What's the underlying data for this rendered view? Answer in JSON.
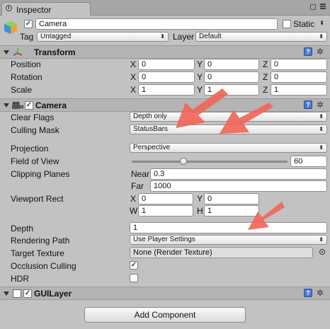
{
  "window": {
    "tab_title": "Inspector"
  },
  "object": {
    "name": "Camera",
    "static_label": "Static",
    "tag_label": "Tag",
    "tag_value": "Untagged",
    "layer_label": "Layer",
    "layer_value": "Default"
  },
  "transform": {
    "title": "Transform",
    "rows": [
      {
        "label": "Position",
        "x": "0",
        "y": "0",
        "z": "0"
      },
      {
        "label": "Rotation",
        "x": "0",
        "y": "0",
        "z": "0"
      },
      {
        "label": "Scale",
        "x": "1",
        "y": "1",
        "z": "1"
      }
    ],
    "axis_x": "X",
    "axis_y": "Y",
    "axis_z": "Z"
  },
  "camera": {
    "title": "Camera",
    "clear_flags_label": "Clear Flags",
    "clear_flags_value": "Depth only",
    "culling_mask_label": "Culling Mask",
    "culling_mask_value": "StatusBars",
    "projection_label": "Projection",
    "projection_value": "Perspective",
    "fov_label": "Field of View",
    "fov_value": "60",
    "clipping_label": "Clipping Planes",
    "near_label": "Near",
    "near_value": "0.3",
    "far_label": "Far",
    "far_value": "1000",
    "viewport_label": "Viewport Rect",
    "vp_x_label": "X",
    "vp_x": "0",
    "vp_y_label": "Y",
    "vp_y": "0",
    "vp_w_label": "W",
    "vp_w": "1",
    "vp_h_label": "H",
    "vp_h": "1",
    "depth_label": "Depth",
    "depth_value": "1",
    "rendering_path_label": "Rendering Path",
    "rendering_path_value": "Use Player Settings",
    "target_texture_label": "Target Texture",
    "target_texture_value": "None (Render Texture)",
    "occlusion_label": "Occlusion Culling",
    "hdr_label": "HDR"
  },
  "guilayer": {
    "title": "GUILayer"
  },
  "add_component_label": "Add Component",
  "icons": {
    "help": "?",
    "gear": "✲",
    "check": "✓",
    "dropdown": "⬍"
  },
  "colors": {
    "annotation_arrow": "#f0665a"
  }
}
